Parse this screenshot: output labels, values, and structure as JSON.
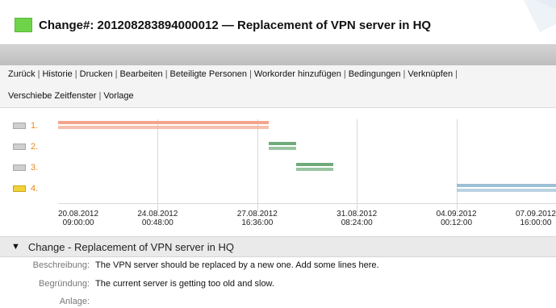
{
  "header": {
    "status_color": "#6fd34a",
    "title": "Change#: 201208283894000012 — Replacement of VPN server in HQ"
  },
  "menu": {
    "line1": [
      "Zurück",
      "Historie",
      "Drucken",
      "Bearbeiten",
      "Beteiligte Personen",
      "Workorder hinzufügen",
      "Bedingungen",
      "Verknüpfen"
    ],
    "line2": [
      "Verschiebe Zeitfenster",
      "Vorlage"
    ],
    "separator": "|"
  },
  "gantt": {
    "rows": [
      {
        "label": "1.",
        "color": "#f4a48a",
        "start": "20.08.2012 09:00:00",
        "end": "28.08.2012 03:00:00"
      },
      {
        "label": "2.",
        "color": "#6fab7a",
        "start": "28.08.2012 03:00:00",
        "end": "29.08.2012 03:00:00"
      },
      {
        "label": "3.",
        "color": "#6fab7a",
        "start": "29.08.2012 03:00:00",
        "end": "30.08.2012 12:00:00"
      },
      {
        "label": "4.",
        "color": "#9cc1d6",
        "start": "04.09.2012 00:12:00",
        "end": "07.09.2012 16:00:00"
      }
    ],
    "ticks": [
      {
        "date": "20.08.2012",
        "time": "09:00:00"
      },
      {
        "date": "24.08.2012",
        "time": "00:48:00"
      },
      {
        "date": "27.08.2012",
        "time": "16:36:00"
      },
      {
        "date": "31.08.2012",
        "time": "08:24:00"
      },
      {
        "date": "04.09.2012",
        "time": "00:12:00"
      },
      {
        "date": "07.09.2012",
        "time": "16:00:00"
      }
    ]
  },
  "section": {
    "toggle": "▼",
    "title": "Change - Replacement of VPN server in HQ",
    "fields": [
      {
        "label": "Beschreibung:",
        "value": "The VPN server should be replaced by a new one. Add some lines here."
      },
      {
        "label": "Begründung:",
        "value": "The current server is getting too old and slow."
      },
      {
        "label": "Anlage:",
        "value": ""
      }
    ]
  }
}
